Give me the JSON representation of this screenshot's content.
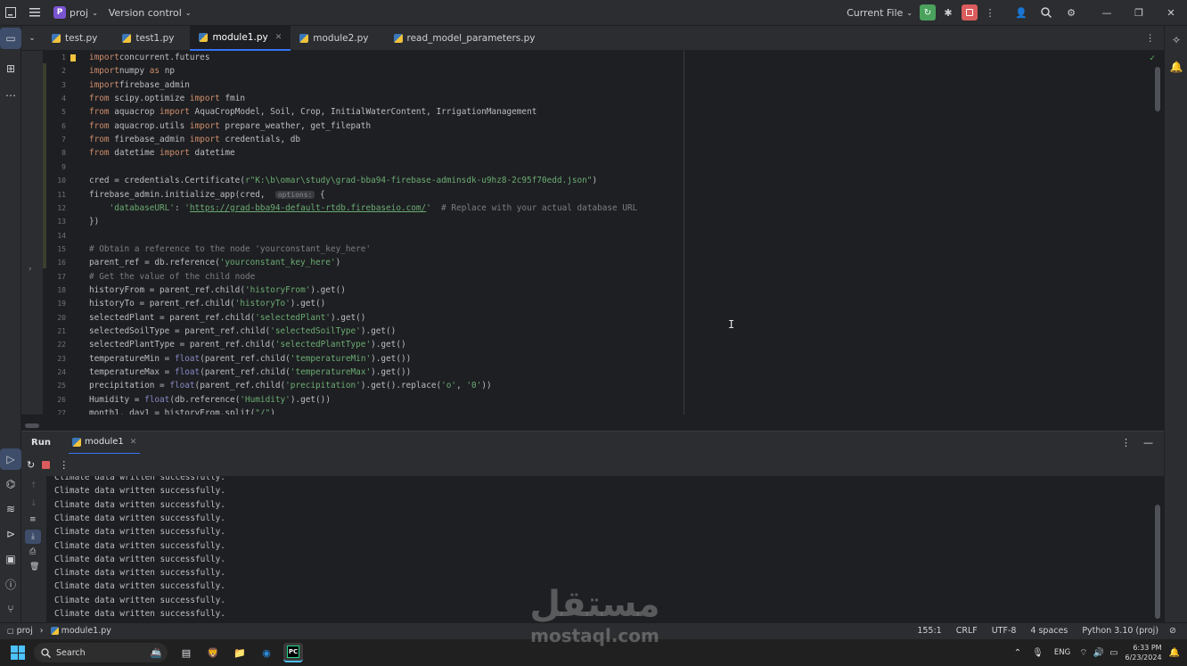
{
  "titlebar": {
    "project_badge": "P",
    "project_name": "proj",
    "version_control": "Version control",
    "run_config": "Current File"
  },
  "tabs": [
    {
      "label": "test.py",
      "active": false
    },
    {
      "label": "test1.py",
      "active": false
    },
    {
      "label": "module1.py",
      "active": true
    },
    {
      "label": "module2.py",
      "active": false
    },
    {
      "label": "read_model_parameters.py",
      "active": false
    }
  ],
  "editor": {
    "line_numbers": [
      "1",
      "2",
      "3",
      "4",
      "5",
      "6",
      "7",
      "8",
      "9",
      "10",
      "11",
      "12",
      "13",
      "14",
      "15",
      "16",
      "17",
      "18",
      "19",
      "20",
      "21",
      "22",
      "23",
      "24",
      "25",
      "26",
      "27"
    ],
    "lines": [
      {
        "n": "1",
        "t": [
          [
            "kw",
            "import"
          ],
          [
            "",
            "concurrent.futures"
          ]
        ]
      },
      {
        "n": "2",
        "t": [
          [
            "kw",
            "import"
          ],
          [
            "",
            "numpy "
          ],
          [
            "kw",
            "as"
          ],
          [
            "",
            " np"
          ]
        ]
      },
      {
        "n": "3",
        "t": [
          [
            "kw",
            "import"
          ],
          [
            "",
            "firebase_admin"
          ]
        ]
      },
      {
        "n": "4",
        "t": [
          [
            "kw",
            "from"
          ],
          [
            "",
            " scipy.optimize "
          ],
          [
            "kw",
            "import"
          ],
          [
            "",
            " fmin"
          ]
        ]
      },
      {
        "n": "5",
        "t": [
          [
            "kw",
            "from"
          ],
          [
            "",
            " aquacrop "
          ],
          [
            "kw",
            "import"
          ],
          [
            "",
            " AquaCropModel, Soil, Crop, InitialWaterContent, IrrigationManagement"
          ]
        ]
      },
      {
        "n": "6",
        "t": [
          [
            "kw",
            "from"
          ],
          [
            "",
            " aquacrop.utils "
          ],
          [
            "kw",
            "import"
          ],
          [
            "",
            " prepare_weather, get_filepath"
          ]
        ]
      },
      {
        "n": "7",
        "t": [
          [
            "kw",
            "from"
          ],
          [
            "",
            " firebase_admin "
          ],
          [
            "kw",
            "import"
          ],
          [
            "",
            " credentials, db"
          ]
        ]
      },
      {
        "n": "8",
        "t": [
          [
            "kw",
            "from"
          ],
          [
            "",
            " datetime "
          ],
          [
            "kw",
            "import"
          ],
          [
            "",
            " datetime"
          ]
        ]
      },
      {
        "n": "9",
        "t": []
      },
      {
        "n": "10",
        "t": [
          [
            "",
            "cred = credentials.Certificate("
          ],
          [
            "str",
            "r\"K:\\b\\omar\\study\\grad-bba94-firebase-adminsdk-u9hz8-2c95f70edd.json\""
          ],
          [
            "",
            ")"
          ]
        ]
      },
      {
        "n": "11",
        "t": [
          [
            "",
            "firebase_admin.initialize_app(cred,  "
          ],
          [
            "hint",
            "options:"
          ],
          [
            "",
            " {"
          ]
        ]
      },
      {
        "n": "12",
        "t": [
          [
            "",
            "    "
          ],
          [
            "str",
            "'databaseURL'"
          ],
          [
            "",
            ": "
          ],
          [
            "str",
            "'"
          ],
          [
            "link",
            "https://grad-bba94-default-rtdb.firebaseio.com/"
          ],
          [
            "str",
            "'"
          ],
          [
            "cm",
            "  # Replace with your actual database URL"
          ]
        ]
      },
      {
        "n": "13",
        "t": [
          [
            "",
            "})"
          ]
        ]
      },
      {
        "n": "14",
        "t": []
      },
      {
        "n": "15",
        "t": [
          [
            "cm",
            "# Obtain a reference to the node 'yourconstant_key_here'"
          ]
        ]
      },
      {
        "n": "16",
        "t": [
          [
            "",
            "parent_ref = db.reference("
          ],
          [
            "str",
            "'yourconstant_key_here'"
          ],
          [
            "",
            ")"
          ]
        ]
      },
      {
        "n": "17",
        "t": [
          [
            "cm",
            "# Get the value of the child node"
          ]
        ]
      },
      {
        "n": "18",
        "t": [
          [
            "",
            "historyFrom = parent_ref.child("
          ],
          [
            "str",
            "'historyFrom'"
          ],
          [
            "",
            ").get()"
          ]
        ]
      },
      {
        "n": "19",
        "t": [
          [
            "",
            "historyTo = parent_ref.child("
          ],
          [
            "str",
            "'historyTo'"
          ],
          [
            "",
            ").get()"
          ]
        ]
      },
      {
        "n": "20",
        "t": [
          [
            "",
            "selectedPlant = parent_ref.child("
          ],
          [
            "str",
            "'selectedPlant'"
          ],
          [
            "",
            ").get()"
          ]
        ]
      },
      {
        "n": "21",
        "t": [
          [
            "",
            "selectedSoilType = parent_ref.child("
          ],
          [
            "str",
            "'selectedSoilType'"
          ],
          [
            "",
            ").get()"
          ]
        ]
      },
      {
        "n": "22",
        "t": [
          [
            "",
            "selectedPlantType = parent_ref.child("
          ],
          [
            "str",
            "'selectedPlantType'"
          ],
          [
            "",
            ").get()"
          ]
        ]
      },
      {
        "n": "23",
        "t": [
          [
            "",
            "temperatureMin = "
          ],
          [
            "bi",
            "float"
          ],
          [
            "",
            "(parent_ref.child("
          ],
          [
            "str",
            "'temperatureMin'"
          ],
          [
            "",
            ").get())"
          ]
        ]
      },
      {
        "n": "24",
        "t": [
          [
            "",
            "temperatureMax = "
          ],
          [
            "bi",
            "float"
          ],
          [
            "",
            "(parent_ref.child("
          ],
          [
            "str",
            "'temperatureMax'"
          ],
          [
            "",
            ").get())"
          ]
        ]
      },
      {
        "n": "25",
        "t": [
          [
            "",
            "precipitation = "
          ],
          [
            "bi",
            "float"
          ],
          [
            "",
            "(parent_ref.child("
          ],
          [
            "str",
            "'precipitation'"
          ],
          [
            "",
            ").get().replace("
          ],
          [
            "str",
            "'o'"
          ],
          [
            "",
            ", "
          ],
          [
            "str",
            "'0'"
          ],
          [
            "",
            "))"
          ]
        ]
      },
      {
        "n": "26",
        "t": [
          [
            "",
            "Humidity = "
          ],
          [
            "bi",
            "float"
          ],
          [
            "",
            "(db.reference("
          ],
          [
            "str",
            "'Humidity'"
          ],
          [
            "",
            ").get())"
          ]
        ]
      },
      {
        "n": "27",
        "t": [
          [
            "",
            "month1, day1 = historyFrom.split("
          ],
          [
            "str",
            "\"/\""
          ],
          [
            "",
            ")"
          ]
        ]
      }
    ]
  },
  "run_panel": {
    "title": "Run",
    "tab_label": "module1",
    "console_lines": [
      "Climate data written successfully.",
      "Climate data written successfully.",
      "Climate data written successfully.",
      "Climate data written successfully.",
      "Climate data written successfully.",
      "Climate data written successfully.",
      "Climate data written successfully.",
      "Climate data written successfully.",
      "Climate data written successfully.",
      "Climate data written successfully.",
      "Climate data written successfully."
    ]
  },
  "statusbar": {
    "breadcrumb_project": "proj",
    "breadcrumb_file": "module1.py",
    "position": "155:1",
    "line_ending": "CRLF",
    "encoding": "UTF-8",
    "indent": "4 spaces",
    "interpreter": "Python 3.10 (proj)"
  },
  "taskbar": {
    "search_label": "Search",
    "language": "ENG",
    "time": "6:33 PM",
    "date": "6/23/2024"
  },
  "watermark": {
    "arabic": "مستقل",
    "latin": "mostaql.com"
  },
  "colors": {
    "accent": "#3574f0",
    "keyword": "#cf8e6d",
    "string": "#6aab73",
    "comment": "#7a7e85",
    "run_green": "#4aa25c",
    "stop_red": "#db5c5c"
  }
}
